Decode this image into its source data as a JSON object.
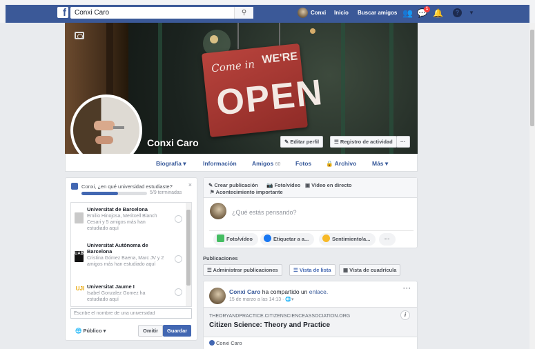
{
  "topbar": {
    "logo": "f",
    "search_value": "Conxi Caro",
    "search_icon": "magnifier",
    "user_name": "Conxi",
    "home": "Inicio",
    "find_friends": "Buscar amigos",
    "notif_count": "1",
    "brand_color": "#3b5998"
  },
  "cover": {
    "sign_come": "Come in",
    "sign_were": "WE'RE",
    "sign_open": "OPEN",
    "profile_name": "Conxi Caro",
    "edit_profile": "Editar perfil",
    "activity_log": "Registro de actividad",
    "more": "···"
  },
  "profile_nav": {
    "timeline": "Biografía ▾",
    "info": "Información",
    "friends": "Amigos",
    "friends_count": "60",
    "photos": "Fotos",
    "archive": "Archivo",
    "more": "Más ▾"
  },
  "university_card": {
    "question": "Conxi, ¿en qué universidad estudiaste?",
    "progress_text": "5/9 terminadas",
    "progress_fraction": 0.56,
    "close": "×",
    "universities": [
      {
        "name": "Universitat de Barcelona",
        "sub": "Emilio Hinojosa, Meritxell Blanch Cesari y 5 amigos más han estudiado aquí"
      },
      {
        "name": "Universitat Autònoma de Barcelona",
        "sub": "Cristina Gómez Baena, Marc JV y 2 amigos más han estudiado aquí",
        "logo": "UAB"
      },
      {
        "name": "Universitat Jaume I",
        "sub": "Isabel Gonzalez Gomez ha estudiado aquí",
        "logo": "UJI"
      }
    ],
    "input_placeholder": "Escribe el nombre de una universidad",
    "privacy": "Público ▾",
    "skip": "Omitir",
    "save": "Guardar"
  },
  "composer": {
    "create_post": "Crear publicación",
    "photo_video": "Foto/vídeo",
    "live_video": "Vídeo en directo",
    "life_event": "Acontecimiento importante",
    "placeholder": "¿Qué estás pensando?",
    "btn_photo": "Foto/vídeo",
    "btn_tag": "Etiquetar a a...",
    "btn_feeling": "Sentimiento/a...",
    "btn_more": "···"
  },
  "publications": {
    "heading": "Publicaciones",
    "manage": "Administrar publicaciones",
    "list_view": "Vista de lista",
    "grid_view": "Vista de cuadrícula"
  },
  "post": {
    "author": "Conxi Caro",
    "action": "ha compartido un",
    "link_word": "enlace.",
    "time": "15 de marzo a las 14:13 · ",
    "audience_icon": "globe-icon",
    "more": "···",
    "domain": "THEORYANDPRACTICE.CITIZENSCIENCEASSOCIATION.ORG",
    "title": "Citizen Science: Theory and Practice",
    "info": "i",
    "footer_name": "Conxi Caro"
  }
}
